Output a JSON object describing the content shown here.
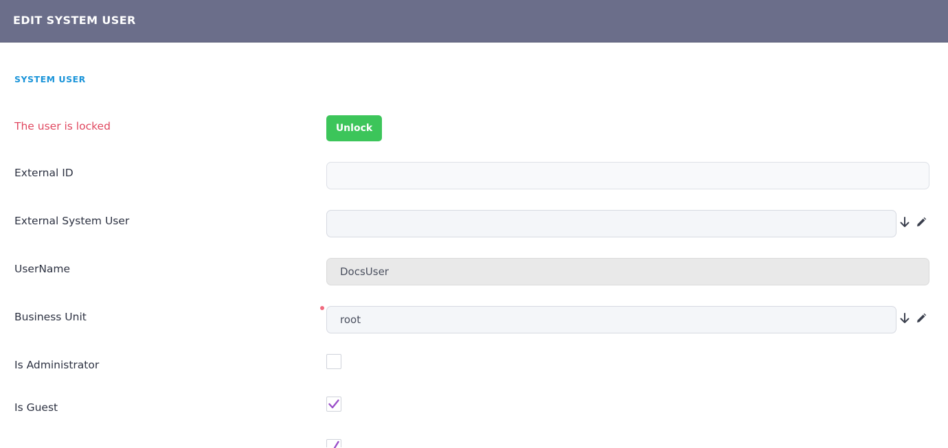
{
  "header": {
    "title": "EDIT SYSTEM USER"
  },
  "section": {
    "title": "SYSTEM USER"
  },
  "locked": {
    "message": "The user is locked",
    "unlock_label": "Unlock"
  },
  "fields": {
    "external_id": {
      "label": "External ID",
      "value": ""
    },
    "external_system_user": {
      "label": "External System User",
      "value": ""
    },
    "username": {
      "label": "UserName",
      "value": "DocsUser"
    },
    "business_unit": {
      "label": "Business Unit",
      "value": "root"
    },
    "is_administrator": {
      "label": "Is Administrator",
      "checked": false
    },
    "is_guest": {
      "label": "Is Guest",
      "checked": true
    },
    "next_row": {
      "checked": true
    }
  },
  "icons": {
    "lookup": "arrow-down-icon",
    "edit": "pencil-icon",
    "check": "check-icon"
  },
  "colors": {
    "header_bg": "#6b6e8a",
    "accent_blue": "#1a94d9",
    "locked_red": "#e0475f",
    "unlock_green": "#3cc55a",
    "check_purple": "#9b4fc9"
  }
}
